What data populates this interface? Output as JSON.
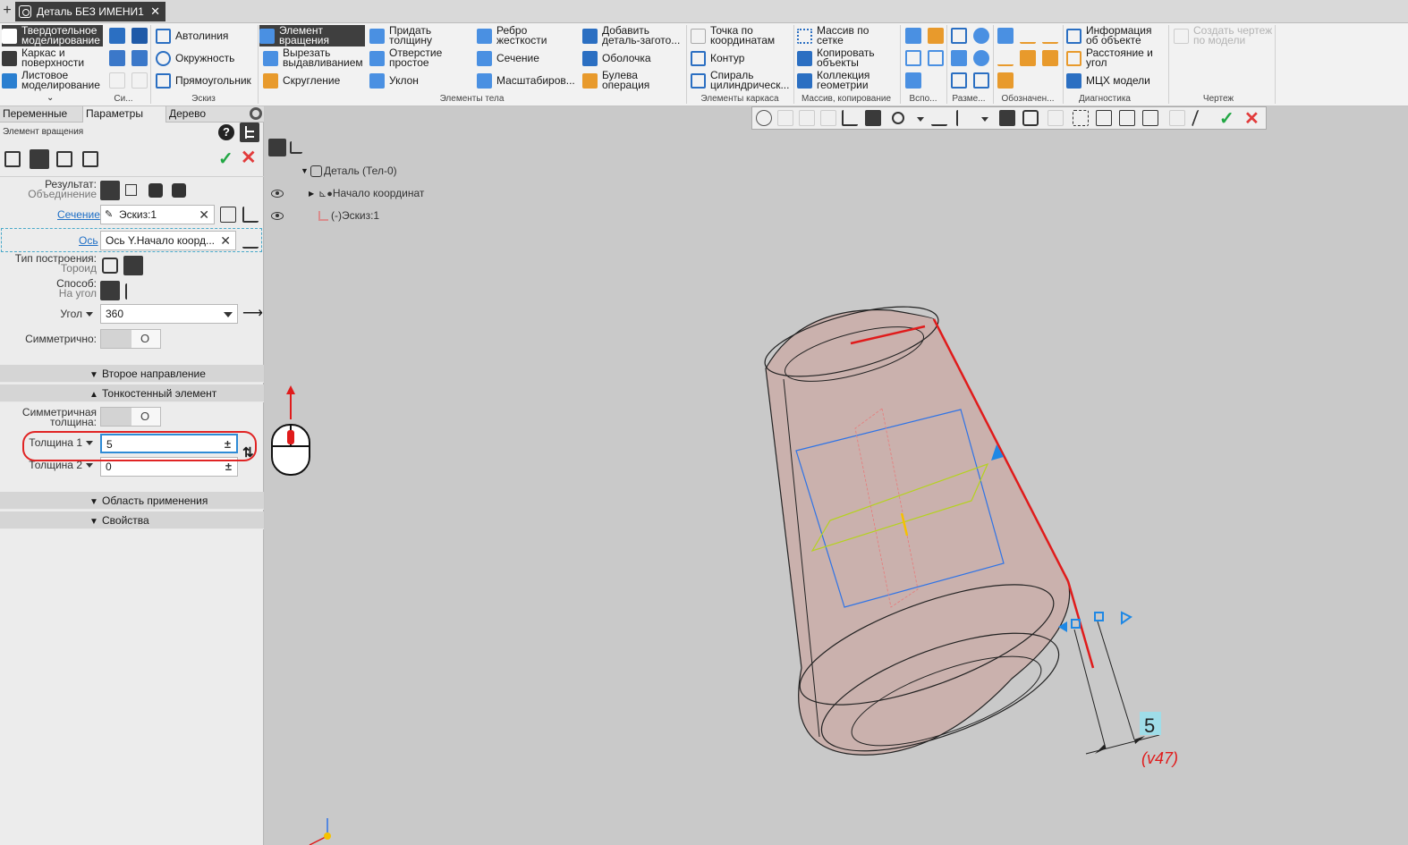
{
  "window": {
    "new_tab_symbol": "+",
    "doc_tab_title": "Деталь БЕЗ ИМЕНИ1",
    "doc_tab_close": "✕"
  },
  "ribbon": {
    "modes": [
      {
        "label": "Твердотельное моделирование"
      },
      {
        "label": "Каркас и поверхности"
      },
      {
        "label": "Листовое моделирование"
      }
    ],
    "sketch": [
      {
        "label": "Автолиния"
      },
      {
        "label": "Окружность"
      },
      {
        "label": "Прямоугольник"
      }
    ],
    "body": [
      {
        "label": "Элемент вращения"
      },
      {
        "label": "Вырезать выдавливанием"
      },
      {
        "label": "Скругление"
      },
      {
        "label": "Придать толщину"
      },
      {
        "label": "Отверстие простое"
      },
      {
        "label": "Уклон"
      },
      {
        "label": "Ребро жесткости"
      },
      {
        "label": "Сечение"
      },
      {
        "label": "Масштабиров..."
      },
      {
        "label": "Добавить деталь-загото..."
      },
      {
        "label": "Оболочка"
      },
      {
        "label": "Булева операция"
      }
    ],
    "frame": [
      {
        "label": "Точка по координатам"
      },
      {
        "label": "Контур"
      },
      {
        "label": "Спираль цилиндрическ..."
      }
    ],
    "array": [
      {
        "label": "Массив по сетке"
      },
      {
        "label": "Копировать объекты"
      },
      {
        "label": "Коллекция геометрии"
      }
    ],
    "diag": [
      {
        "label": "Информация об объекте"
      },
      {
        "label": "Расстояние и угол"
      },
      {
        "label": "МЦХ модели"
      }
    ],
    "drawing_disabled": "Создать чертеж по модели",
    "groups": {
      "si": "Си...",
      "sketch": "Эскиз",
      "body": "Элементы тела",
      "frame": "Элементы каркаса",
      "array": "Массив, копирование",
      "aux": "Вспо...",
      "dims": "Разме...",
      "notation": "Обозначен...",
      "diag": "Диагностика",
      "drawing": "Чертеж"
    }
  },
  "panel": {
    "tabs": [
      "Переменные",
      "Параметры",
      "Дерево"
    ],
    "active_tab": "Параметры",
    "operation_title": "Элемент вращения",
    "help": "?",
    "result_label": "Результат:",
    "result_value": "Объединение",
    "section_label": "Сечение",
    "section_value": "Эскиз:1",
    "axis_label": "Ось",
    "axis_value": "Ось Y.Начало коорд...",
    "build_type_label": "Тип построения:",
    "build_type_value": "Тороид",
    "method_label": "Способ:",
    "method_value": "На угол",
    "angle_label": "Угол",
    "angle_value": "360",
    "symmetric_label": "Симметрично:",
    "toggle_off": "O",
    "section_second": "Второе направление",
    "section_thin": "Тонкостенный элемент",
    "sym_thickness_label_1": "Симметричная",
    "sym_thickness_label_2": "толщина:",
    "thickness1_label": "Толщина 1",
    "thickness1_value": "5",
    "thickness2_label": "Толщина 2",
    "thickness2_value": "0",
    "plus_minus": "±",
    "section_scope": "Область применения",
    "section_props": "Свойства"
  },
  "tree": {
    "root": "Деталь (Тел-0)",
    "origin": "Начало координат",
    "sketch": "(-)Эскиз:1"
  },
  "viewport": {
    "dim_value": "5",
    "dim_var": "(v47)"
  },
  "colors": {
    "accent_dark": "#3a3a3a",
    "ok_green": "#22a744",
    "cancel_red": "#e23b3b",
    "link_blue": "#1f6fc6",
    "model_fill": "#c9a9a6",
    "edge_red": "#e01b1b",
    "handle_blue": "#1e88e5"
  }
}
